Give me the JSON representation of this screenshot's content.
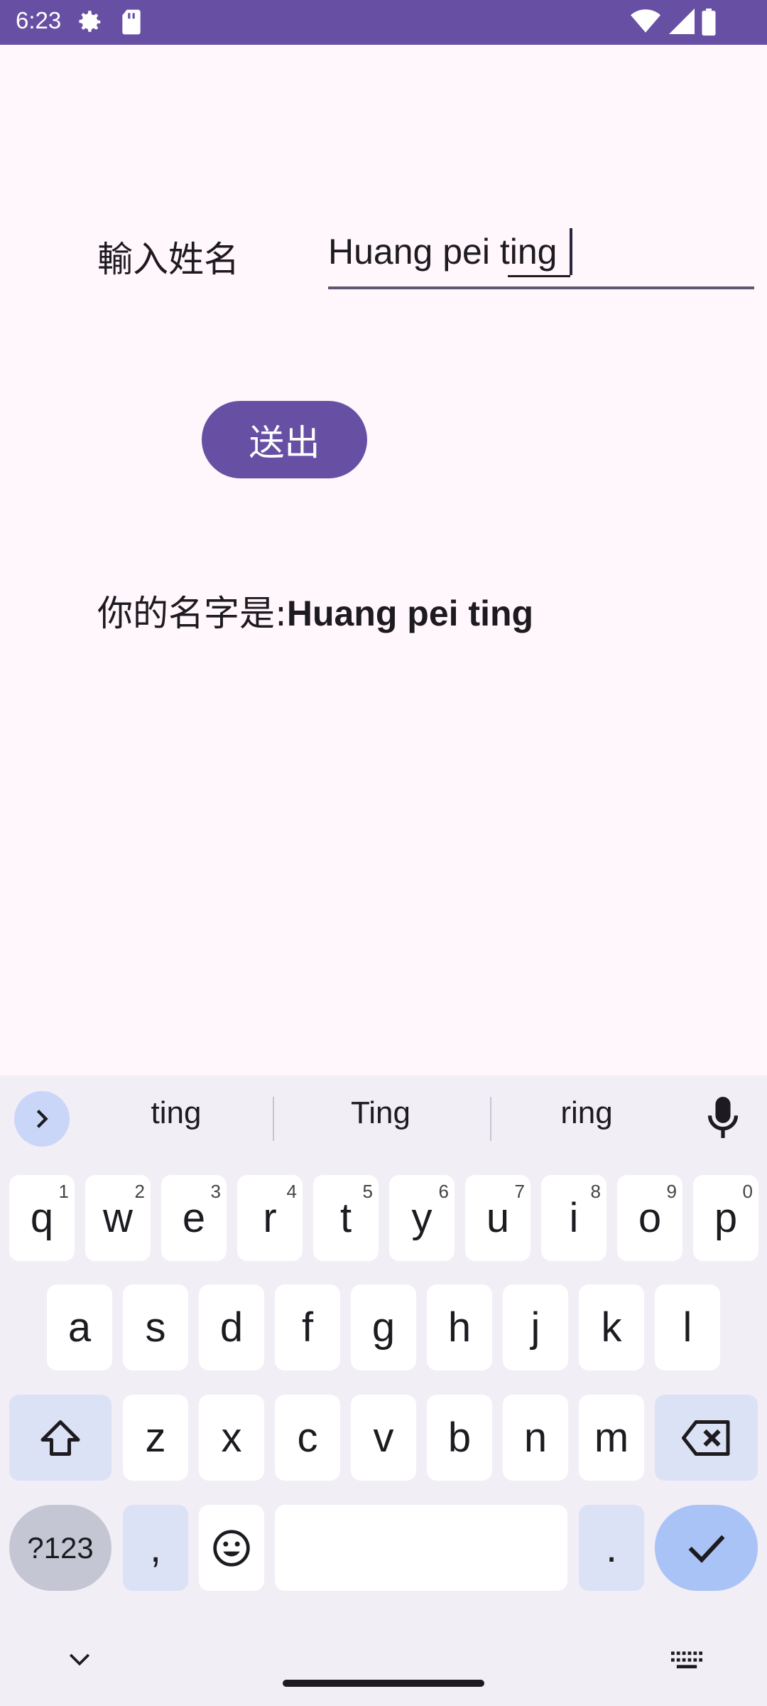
{
  "status_bar": {
    "time": "6:23"
  },
  "form": {
    "name_label": "輸入姓名",
    "name_value": "Huang pei ting",
    "submit_label": "送出",
    "result_prefix": "你的名字是:",
    "result_name": "Huang pei ting"
  },
  "keyboard": {
    "suggestions": [
      "ting",
      "Ting",
      "ring"
    ],
    "row1": [
      {
        "k": "q",
        "s": "1"
      },
      {
        "k": "w",
        "s": "2"
      },
      {
        "k": "e",
        "s": "3"
      },
      {
        "k": "r",
        "s": "4"
      },
      {
        "k": "t",
        "s": "5"
      },
      {
        "k": "y",
        "s": "6"
      },
      {
        "k": "u",
        "s": "7"
      },
      {
        "k": "i",
        "s": "8"
      },
      {
        "k": "o",
        "s": "9"
      },
      {
        "k": "p",
        "s": "0"
      }
    ],
    "row2": [
      "a",
      "s",
      "d",
      "f",
      "g",
      "h",
      "j",
      "k",
      "l"
    ],
    "row3": [
      "z",
      "x",
      "c",
      "v",
      "b",
      "n",
      "m"
    ],
    "symbols_label": "?123",
    "comma_label": ",",
    "period_label": "."
  },
  "colors": {
    "accent": "#6750A4",
    "background": "#FFF7FC",
    "keyboard_bg": "#F1EEF6"
  }
}
